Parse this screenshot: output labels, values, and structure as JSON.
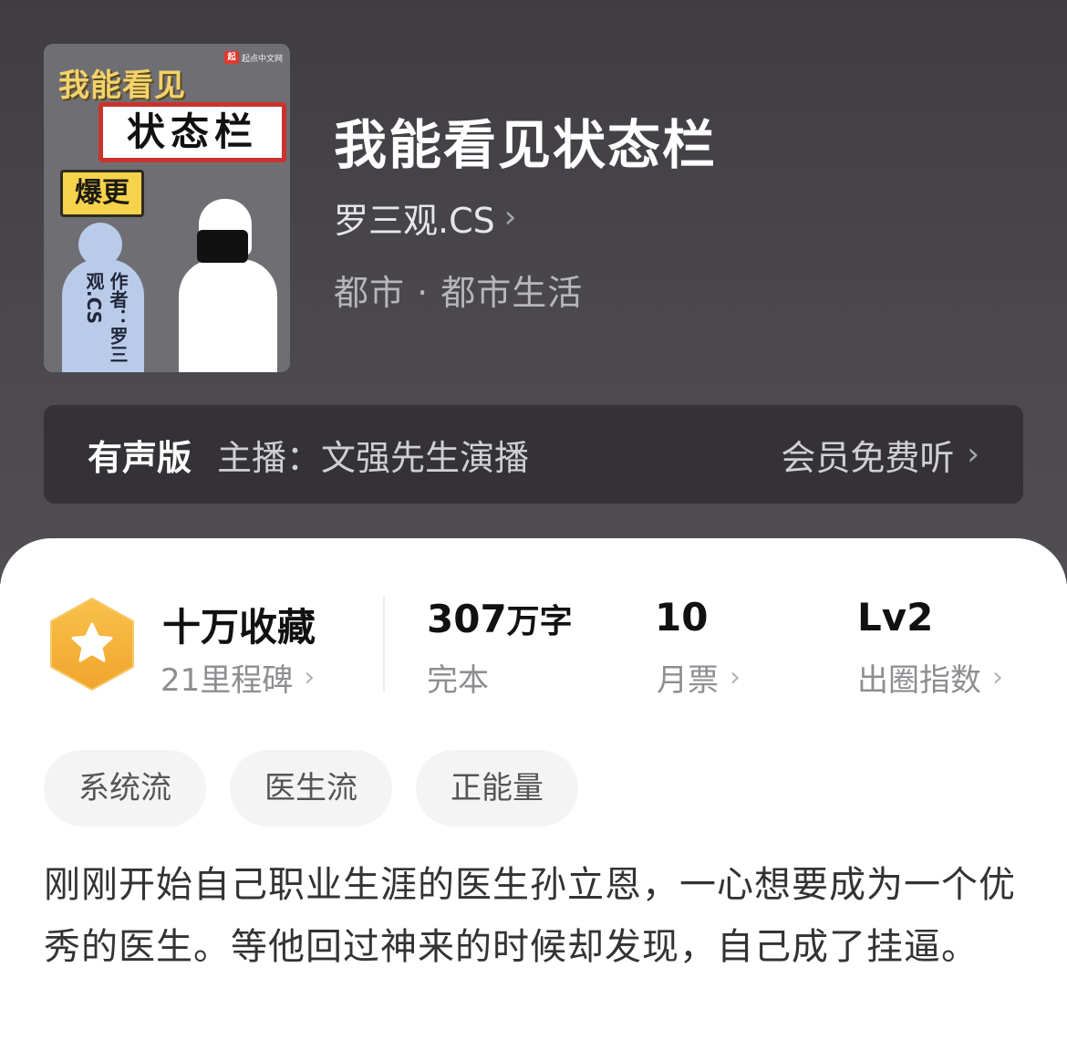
{
  "book": {
    "title": "我能看见状态栏",
    "author": "罗三观.CS",
    "genre": "都市 · 都市生活"
  },
  "cover": {
    "publisher": "起点中文网",
    "publisher_logo": "起",
    "title_line1": "我能看见",
    "title_line2": "状态栏",
    "tag": "爆更",
    "author_line": "作者：罗三观.CS"
  },
  "audio": {
    "label": "有声版",
    "host": "主播：文强先生演播",
    "action": "会员免费听"
  },
  "stats": {
    "favorites": {
      "value": "十万收藏",
      "sub": "21里程碑"
    },
    "words": {
      "value": "307",
      "unit": "万字",
      "sub": "完本"
    },
    "monthly_tickets": {
      "value": "10",
      "sub": "月票"
    },
    "level": {
      "value": "Lv2",
      "sub": "出圈指数"
    }
  },
  "tags": [
    "系统流",
    "医生流",
    "正能量"
  ],
  "description": "刚刚开始自己职业生涯的医生孙立恩，一心想要成为一个优秀的医生。等他回过神来的时候却发现，自己成了挂逼。",
  "colors": {
    "header_bg": "#48464b",
    "audio_bg": "#343237",
    "badge_orange": "#f5b43a",
    "tag_bg": "#f4f4f4"
  }
}
